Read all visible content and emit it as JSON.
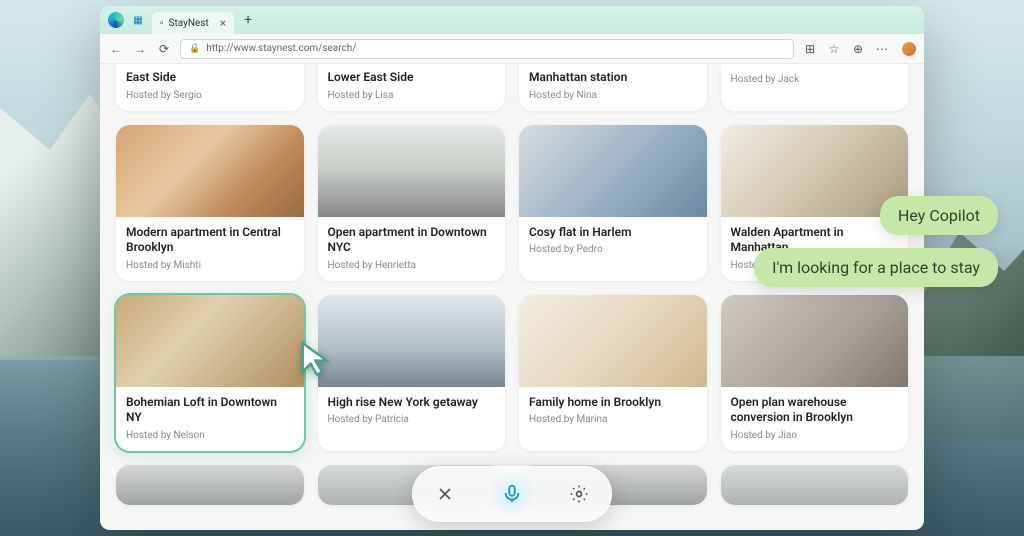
{
  "browser": {
    "tab_title": "StayNest",
    "url": "http://www.staynest.com/search/"
  },
  "listings_partial": [
    {
      "title": "East Side",
      "host": "Hosted by Sergio"
    },
    {
      "title": "Lower East Side",
      "host": "Hosted by Lisa"
    },
    {
      "title": "Manhattan station",
      "host": "Hosted by Nina"
    },
    {
      "title": "",
      "host": "Hosted by Jack"
    }
  ],
  "listings": [
    {
      "title": "Modern apartment in Central Brooklyn",
      "host": "Hosted by Mishti"
    },
    {
      "title": "Open apartment in Downtown NYC",
      "host": "Hosted by Henrietta"
    },
    {
      "title": "Cosy flat in Harlem",
      "host": "Hosted by Pedro"
    },
    {
      "title": "Walden Apartment in Manhattan",
      "host": "Hosted by"
    },
    {
      "title": "Bohemian Loft in Downtown NY",
      "host": "Hosted by Nelson"
    },
    {
      "title": "High rise New York getaway",
      "host": "Hosted by Patricia"
    },
    {
      "title": "Family home in Brooklyn",
      "host": "Hosted by Marina"
    },
    {
      "title": "Open plan warehouse conversion in Brooklyn",
      "host": "Hosted by Jiao"
    }
  ],
  "copilot": {
    "greeting": "Hey Copilot",
    "query": "I'm looking for a place to stay"
  }
}
